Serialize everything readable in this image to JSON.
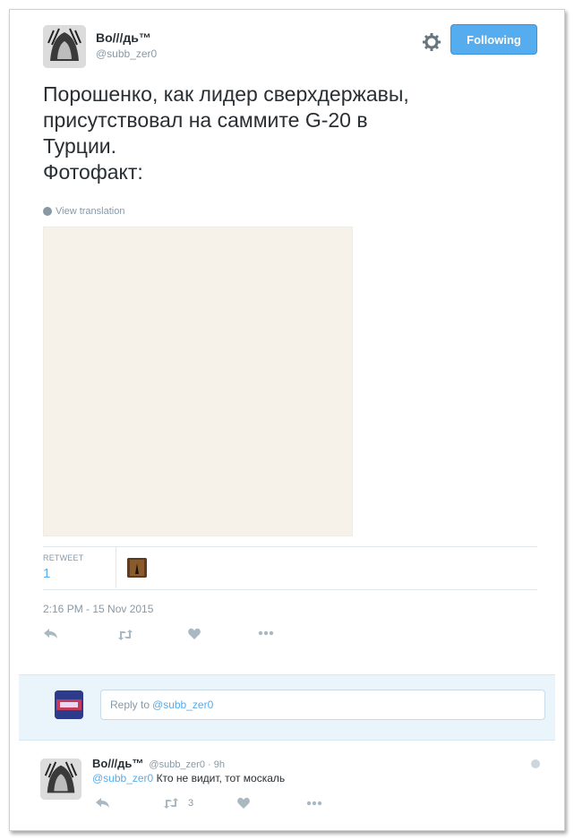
{
  "tweet": {
    "author_name": "Во///дь™",
    "author_handle": "@subb_zer0",
    "follow_button": "Following",
    "text": "Порошенко, как лидер сверхдержавы,\nприсутствовал на саммите G-20 в\nТурции.\nФотофакт:",
    "view_translation": "View translation",
    "retweet_label": "RETWEET",
    "retweet_count": "1",
    "timestamp": "2:16 PM - 15 Nov 2015"
  },
  "reply_box": {
    "placeholder_prefix": "Reply to ",
    "placeholder_mention": "@subb_zer0"
  },
  "reply_tweet": {
    "author_name": "Во///дь™",
    "meta": "@subb_zer0 · 9h",
    "mention": "@subb_zer0",
    "text": " Кто не видит, тот москаль",
    "retweet_count": "3"
  },
  "colors": {
    "accent": "#55acee",
    "muted": "#8899a6",
    "text": "#292f33"
  },
  "icons": [
    "gear-icon",
    "globe-icon",
    "reply-icon",
    "retweet-icon",
    "like-icon",
    "more-icon"
  ]
}
